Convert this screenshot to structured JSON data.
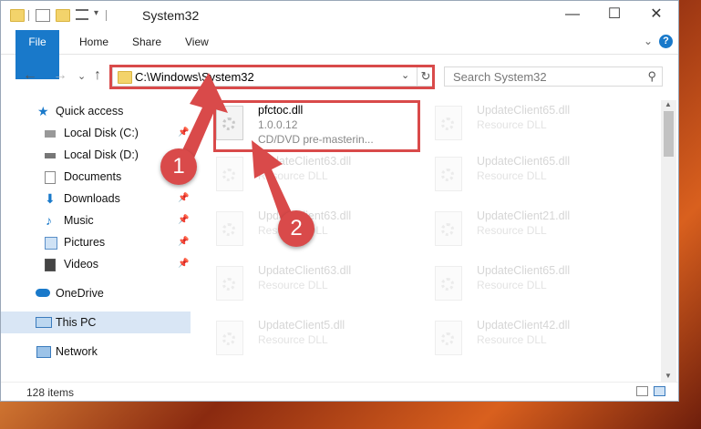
{
  "window": {
    "title": "System32"
  },
  "ribbon": {
    "tabs": [
      "File",
      "Home",
      "Share",
      "View"
    ],
    "help": "?"
  },
  "nav": {
    "back": "←",
    "forward": "→",
    "recent": "⌄",
    "up": "↑",
    "address": "C:\\Windows\\System32",
    "search_placeholder": "Search System32"
  },
  "sidebar": {
    "items": [
      {
        "label": "Quick access",
        "icon": "star-icon"
      },
      {
        "label": "Local Disk (C:)",
        "icon": "drive-icon",
        "pinned": true
      },
      {
        "label": "Local Disk (D:)",
        "icon": "drive-icon"
      },
      {
        "label": "Documents",
        "icon": "documents-icon"
      },
      {
        "label": "Downloads",
        "icon": "download-icon",
        "pinned": true
      },
      {
        "label": "Music",
        "icon": "music-icon",
        "pinned": true
      },
      {
        "label": "Pictures",
        "icon": "pictures-icon",
        "pinned": true
      },
      {
        "label": "Videos",
        "icon": "videos-icon",
        "pinned": true
      },
      {
        "label": "OneDrive",
        "icon": "cloud-icon"
      },
      {
        "label": "This PC",
        "icon": "computer-icon",
        "selected": true
      },
      {
        "label": "Network",
        "icon": "network-icon"
      }
    ]
  },
  "files": {
    "highlighted": {
      "name": "pfctoc.dll",
      "version": "1.0.0.12",
      "description": "CD/DVD pre-masterin..."
    },
    "ghost_left": [
      {
        "name": "UpdateClient63.dll",
        "type": "Resource DLL"
      },
      {
        "name": "UpdateClient63.dll",
        "type": "Resource DLL"
      },
      {
        "name": "UpdateClient63.dll",
        "type": "Resource DLL"
      },
      {
        "name": "UpdateClient5.dll",
        "type": "Resource DLL"
      }
    ],
    "ghost_right": [
      {
        "name": "UpdateClient65.dll",
        "type": "Resource DLL"
      },
      {
        "name": "UpdateClient65.dll",
        "type": "Resource DLL"
      },
      {
        "name": "UpdateClient21.dll",
        "type": "Resource DLL"
      },
      {
        "name": "UpdateClient65.dll",
        "type": "Resource DLL"
      },
      {
        "name": "UpdateClient42.dll",
        "type": "Resource DLL"
      }
    ]
  },
  "status": {
    "items": "128 items"
  },
  "annotations": {
    "step1": "1",
    "step2": "2"
  },
  "colors": {
    "accent": "#1979ca",
    "highlight": "#d94a4a",
    "selected": "#d9e6f5"
  }
}
